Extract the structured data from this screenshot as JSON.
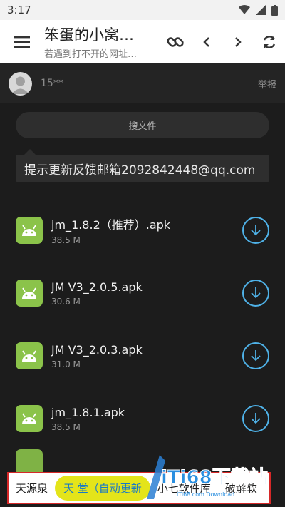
{
  "status_bar": {
    "time": "3:17"
  },
  "header": {
    "title": "笨蛋的小窝…",
    "subtitle": "若遇到打不开的网址…"
  },
  "user": {
    "name": "15**",
    "report_label": "举报"
  },
  "search": {
    "placeholder": "搜文件"
  },
  "notice": {
    "text": "提示更新反馈邮箱2092842448@qq.com"
  },
  "files": [
    {
      "name": "jm_1.8.2（推荐）.apk",
      "size": "38.5 M"
    },
    {
      "name": "JM V3_2.0.5.apk",
      "size": "30.6 M"
    },
    {
      "name": "JM V3_2.0.3.apk",
      "size": "31.0 M"
    },
    {
      "name": "jm_1.8.1.apk",
      "size": "38.5 M"
    }
  ],
  "bottom_strip": {
    "items": [
      "天源泉",
      "天 堂（自动更新",
      "小七软件库",
      "破解软"
    ]
  },
  "watermark": {
    "brand": "iTi68下载站",
    "sub": "iTi68.com Download"
  },
  "colors": {
    "accent": "#4fb2e8",
    "apk_green": "#8bc34a",
    "highlight": "#e4e41a"
  }
}
